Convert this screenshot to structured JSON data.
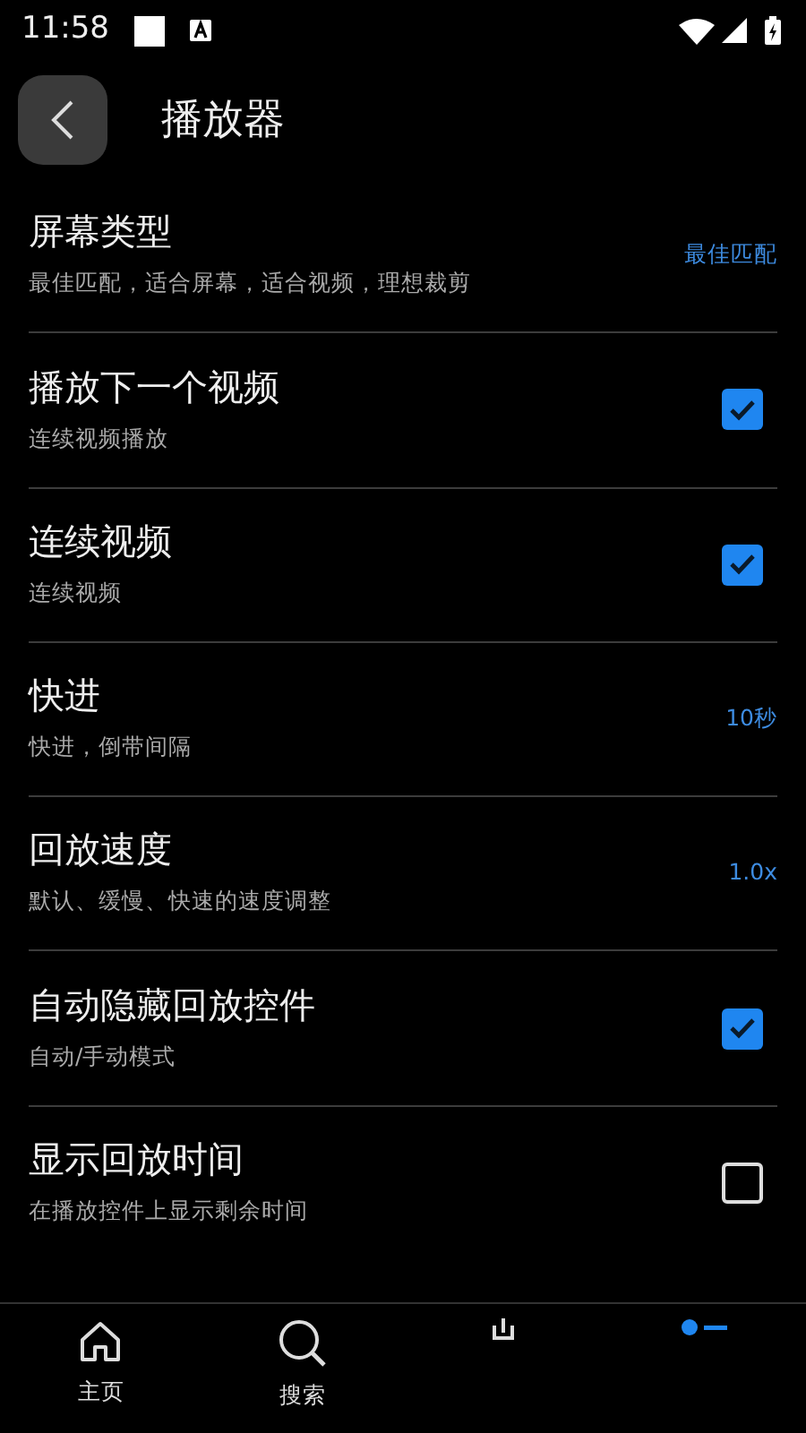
{
  "status_bar": {
    "time": "11:58"
  },
  "header": {
    "title": "播放器"
  },
  "settings": [
    {
      "kind": "value",
      "title": "屏幕类型",
      "subtitle": "最佳匹配，适合屏幕，适合视频，理想裁剪",
      "value": "最佳匹配"
    },
    {
      "kind": "checkbox",
      "title": "播放下一个视频",
      "subtitle": "连续视频播放",
      "checked": true
    },
    {
      "kind": "checkbox",
      "title": "连续视频",
      "subtitle": "连续视频",
      "checked": true
    },
    {
      "kind": "value",
      "title": "快进",
      "subtitle": "快进，倒带间隔",
      "value": "10秒"
    },
    {
      "kind": "value",
      "title": "回放速度",
      "subtitle": "默认、缓慢、快速的速度调整",
      "value": "1.0x"
    },
    {
      "kind": "checkbox",
      "title": "自动隐藏回放控件",
      "subtitle": "自动/手动模式",
      "checked": true
    },
    {
      "kind": "checkbox",
      "title": "显示回放时间",
      "subtitle": "在播放控件上显示剩余时间",
      "checked": false
    }
  ],
  "bottom_nav": [
    {
      "kind": "home",
      "label": "主页"
    },
    {
      "kind": "search",
      "label": "搜索"
    },
    {
      "kind": "download"
    },
    {
      "kind": "list"
    }
  ]
}
